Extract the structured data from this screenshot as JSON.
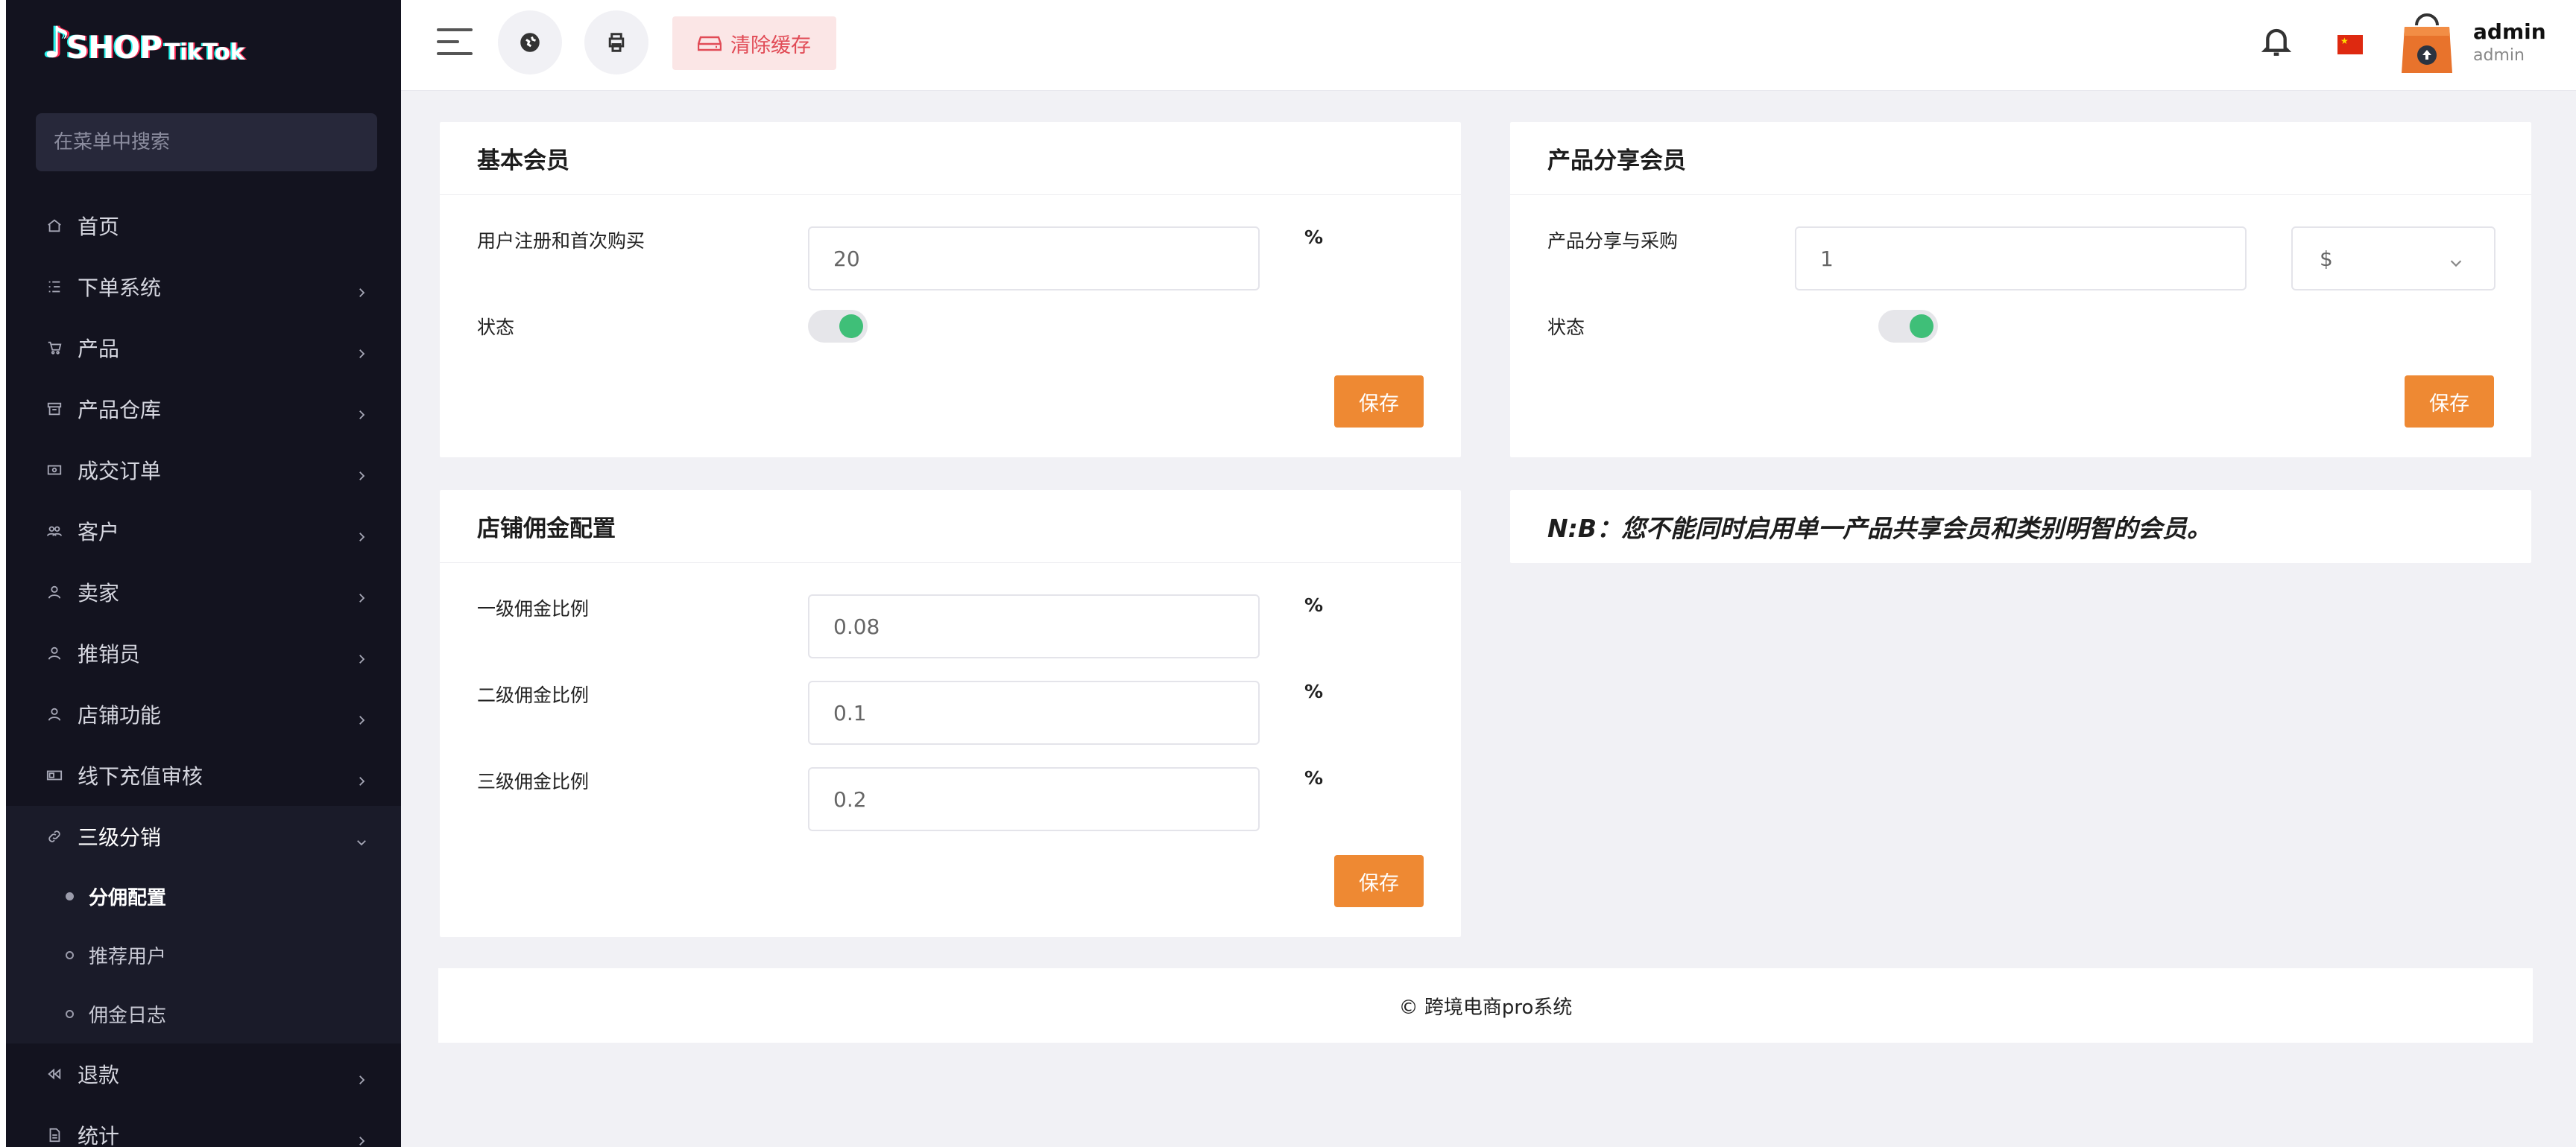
{
  "app": {
    "logo_text": "SHOP",
    "logo_sub": "TikTok",
    "menu_search_placeholder": "在菜单中搜索"
  },
  "sidebar": {
    "items": [
      {
        "label": "首页",
        "icon": "home-icon"
      },
      {
        "label": "下单系统",
        "icon": "list-icon"
      },
      {
        "label": "产品",
        "icon": "cart-icon"
      },
      {
        "label": "产品仓库",
        "icon": "warehouse-icon"
      },
      {
        "label": "成交订单",
        "icon": "order-icon"
      },
      {
        "label": "客户",
        "icon": "users-icon"
      },
      {
        "label": "卖家",
        "icon": "user-icon"
      },
      {
        "label": "推销员",
        "icon": "user-icon"
      },
      {
        "label": "店铺功能",
        "icon": "user-icon"
      },
      {
        "label": "线下充值审核",
        "icon": "cash-icon"
      },
      {
        "label": "三级分销",
        "icon": "link-icon"
      },
      {
        "label": "退款",
        "icon": "refund-icon"
      },
      {
        "label": "统计",
        "icon": "file-icon"
      }
    ],
    "submenu": [
      {
        "label": "分佣配置",
        "active": true
      },
      {
        "label": "推荐用户",
        "active": false
      },
      {
        "label": "佣金日志",
        "active": false
      }
    ]
  },
  "header": {
    "clear_cache_label": "清除缓存",
    "user_name": "admin",
    "user_role": "admin"
  },
  "basic_member": {
    "title": "基本会员",
    "field_label": "用户注册和首次购买",
    "field_value": "20",
    "unit": "%",
    "status_label": "状态",
    "status_on": true,
    "save_label": "保存"
  },
  "product_share": {
    "title": "产品分享会员",
    "field_label": "产品分享与采购",
    "field_value": "1",
    "currency": "$",
    "status_label": "状态",
    "status_on": true,
    "save_label": "保存"
  },
  "commission": {
    "title": "店铺佣金配置",
    "rows": [
      {
        "label": "一级佣金比例",
        "value": "0.08",
        "unit": "%"
      },
      {
        "label": "二级佣金比例",
        "value": "0.1",
        "unit": "%"
      },
      {
        "label": "三级佣金比例",
        "value": "0.2",
        "unit": "%"
      }
    ],
    "save_label": "保存"
  },
  "note": {
    "text": "N:B：您不能同时启用单一产品共享会员和类别明智的会员。"
  },
  "footer": {
    "text": "© 跨境电商pro系统"
  },
  "colors": {
    "sidebar_bg": "#13131f",
    "accent_orange": "#ee8933",
    "toggle_green": "#3fbf78",
    "clear_cache_red": "#e14b56"
  }
}
